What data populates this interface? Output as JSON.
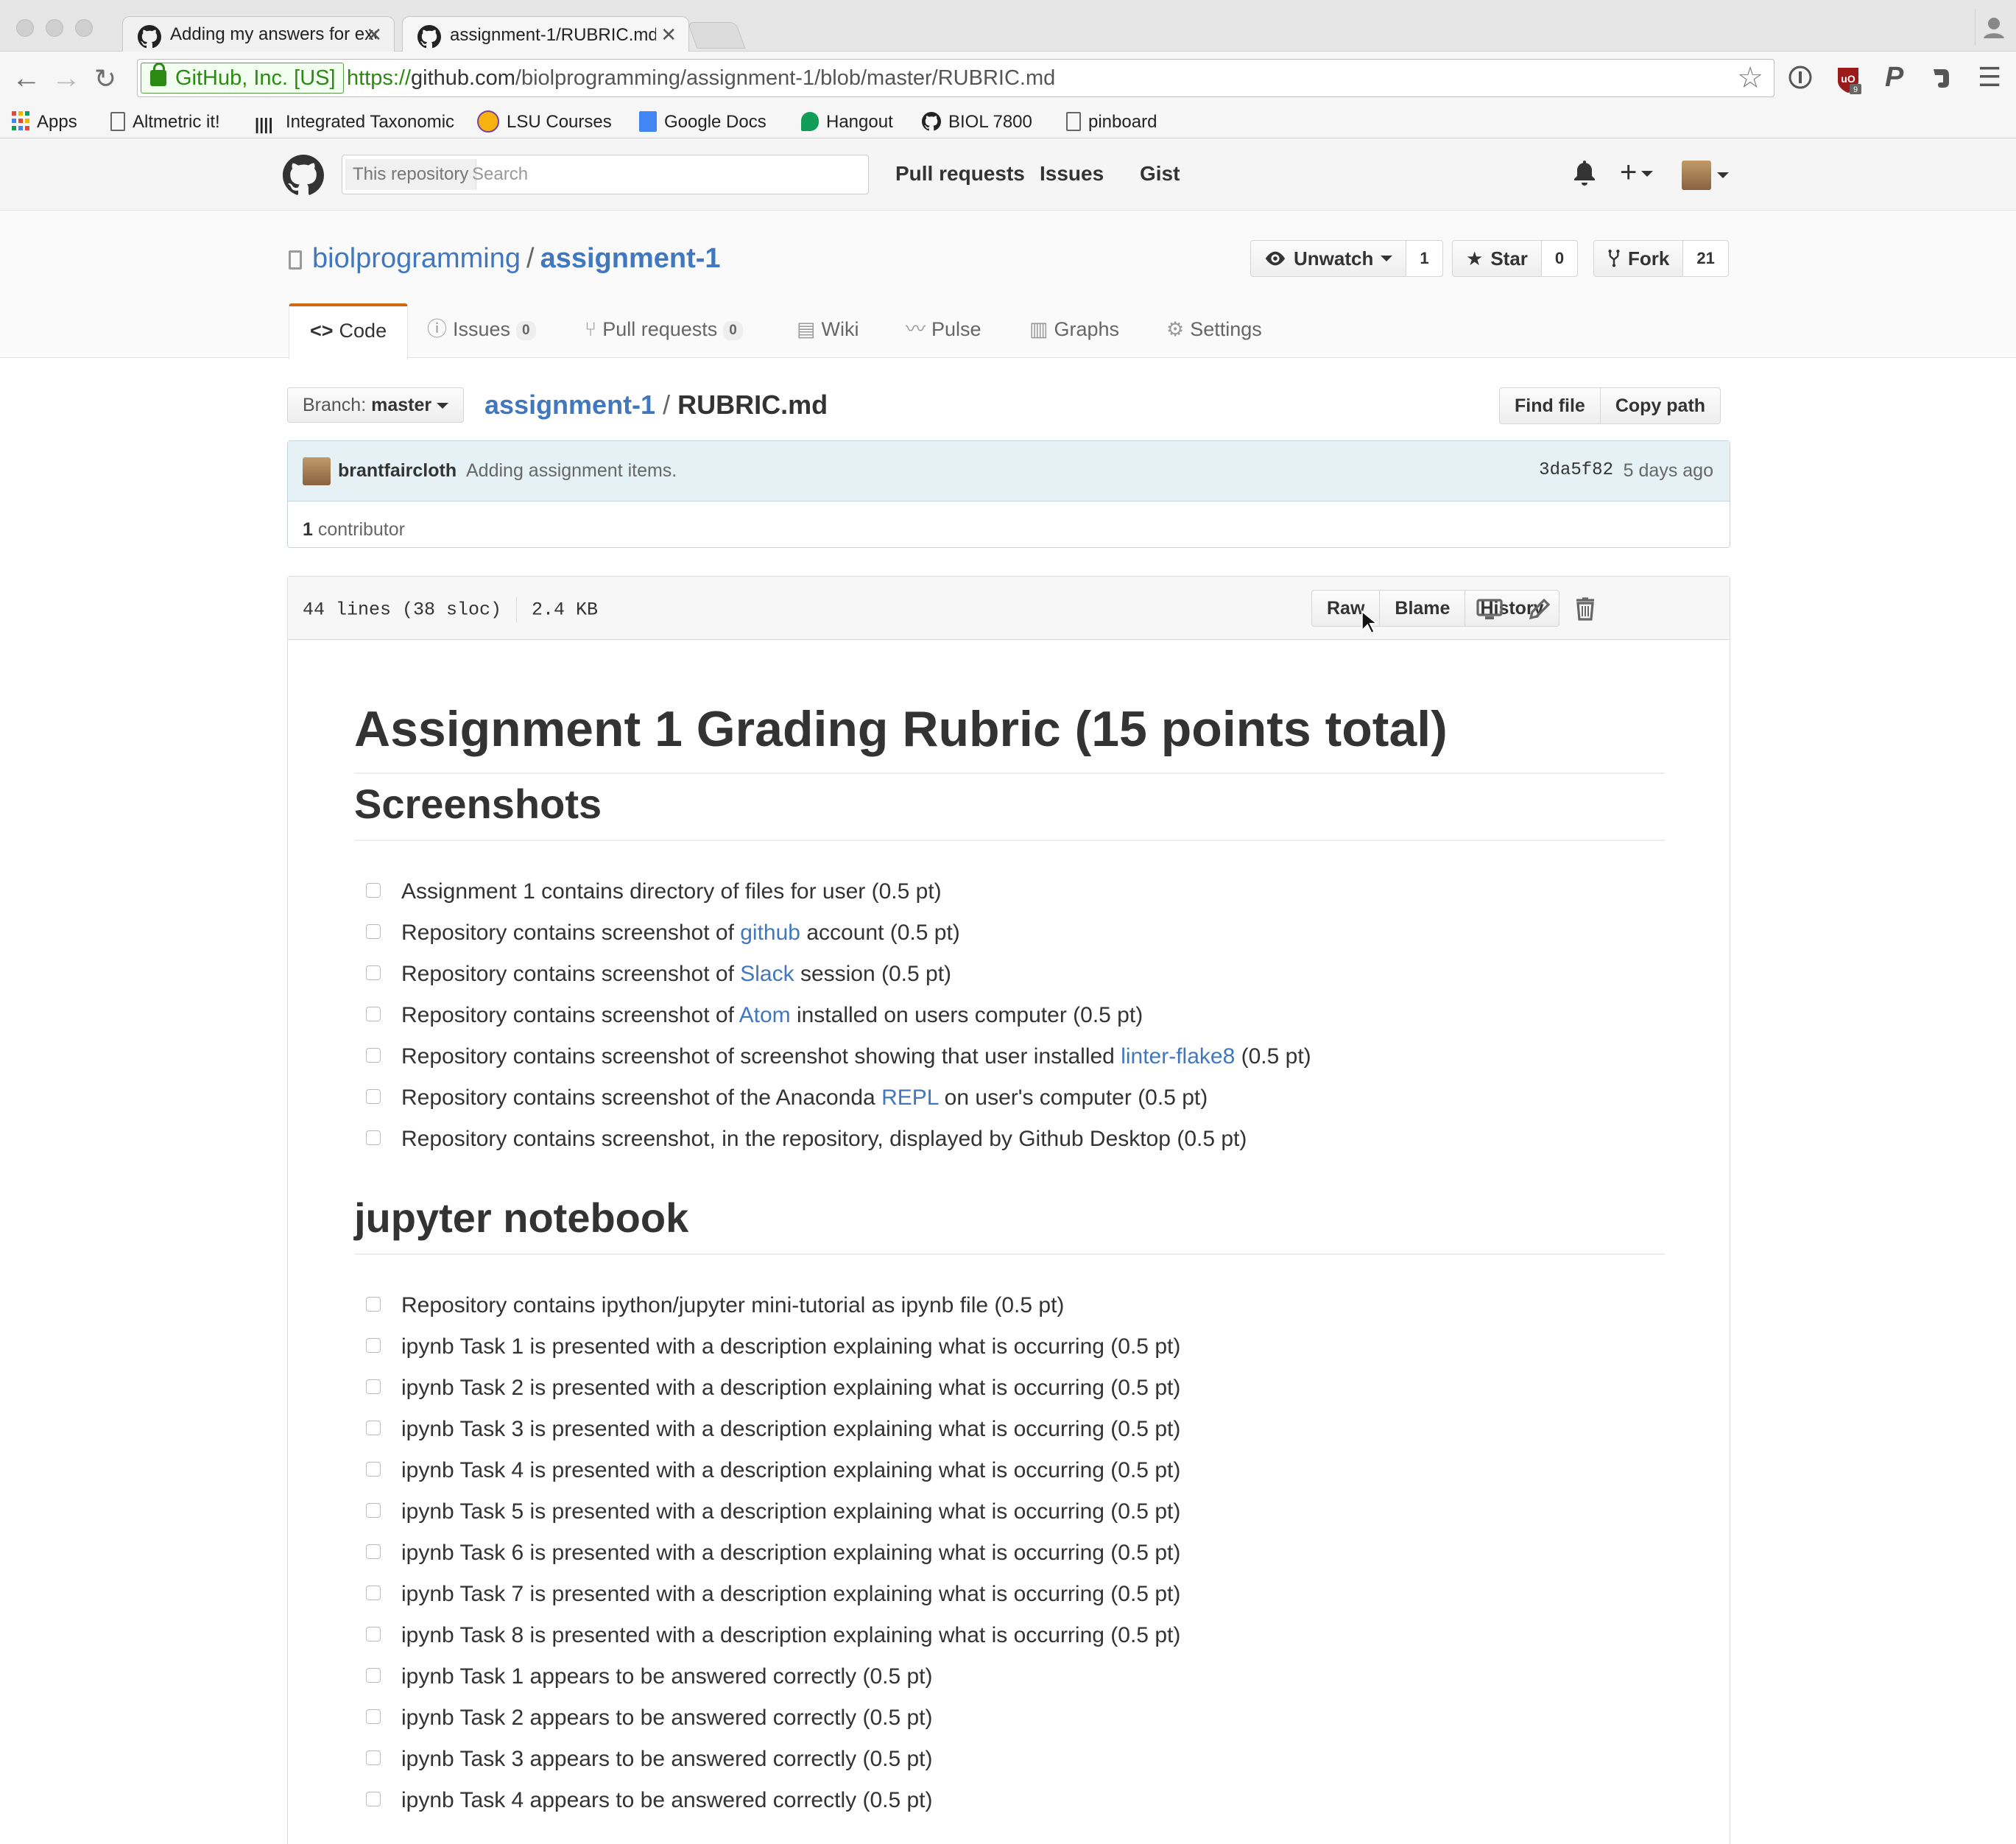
{
  "browser": {
    "tabs": [
      {
        "title": "Adding my answers for exe"
      },
      {
        "title": "assignment-1/RUBRIC.md"
      }
    ],
    "ev_cert": "GitHub, Inc. [US]",
    "url": {
      "scheme": "https://",
      "host": "github.com",
      "path": "/biolprogramming/assignment-1/blob/master/RUBRIC.md"
    },
    "bookmarks": [
      {
        "label": "Apps",
        "icon": "apps-grid-icon"
      },
      {
        "label": "Altmetric it!",
        "icon": "page-icon"
      },
      {
        "label": "Integrated Taxonomic",
        "icon": "itis-icon"
      },
      {
        "label": "LSU Courses",
        "icon": "lsu-icon"
      },
      {
        "label": "Google Docs",
        "icon": "google-docs-icon"
      },
      {
        "label": "Hangout",
        "icon": "hangout-icon"
      },
      {
        "label": "BIOL 7800",
        "icon": "github-icon"
      },
      {
        "label": "pinboard",
        "icon": "page-icon"
      }
    ]
  },
  "github": {
    "search": {
      "scope": "This repository",
      "placeholder": "Search"
    },
    "nav": {
      "pulls": "Pull requests",
      "issues": "Issues",
      "gist": "Gist"
    }
  },
  "repo": {
    "owner": "biolprogramming",
    "separator": "/",
    "name": "assignment-1",
    "watch": {
      "label": "Unwatch",
      "count": "1"
    },
    "star": {
      "label": "Star",
      "count": "0"
    },
    "fork": {
      "label": "Fork",
      "count": "21"
    },
    "tabs": {
      "code": "Code",
      "issues": "Issues",
      "issues_count": "0",
      "pulls": "Pull requests",
      "pulls_count": "0",
      "wiki": "Wiki",
      "pulse": "Pulse",
      "graphs": "Graphs",
      "settings": "Settings"
    }
  },
  "file_nav": {
    "branch_label": "Branch:",
    "branch": "master",
    "crumb_repo": "assignment-1",
    "crumb_sep": "/",
    "crumb_file": "RUBRIC.md",
    "find_file": "Find file",
    "copy_path": "Copy path"
  },
  "commit": {
    "author": "brantfaircloth",
    "message": "Adding assignment items.",
    "sha": "3da5f82",
    "time": "5 days ago",
    "contributors_count": "1",
    "contributors_label": "contributor"
  },
  "file": {
    "lines": "44 lines (38 sloc)",
    "size": "2.4 KB",
    "raw": "Raw",
    "blame": "Blame",
    "history": "History"
  },
  "markdown": {
    "title": "Assignment 1 Grading Rubric (15 points total)",
    "sections": [
      {
        "heading": "Screenshots",
        "items": [
          {
            "pre": "Assignment 1 contains directory of files for user (0.5 pt)",
            "link": "",
            "post": ""
          },
          {
            "pre": "Repository contains screenshot of ",
            "link": "github",
            "post": " account (0.5 pt)"
          },
          {
            "pre": "Repository contains screenshot of ",
            "link": "Slack",
            "post": " session (0.5 pt)"
          },
          {
            "pre": "Repository contains screenshot of ",
            "link": "Atom",
            "post": " installed on users computer (0.5 pt)"
          },
          {
            "pre": "Repository contains screenshot of screenshot showing that user installed ",
            "link": "linter-flake8",
            "post": " (0.5 pt)"
          },
          {
            "pre": "Repository contains screenshot of the Anaconda ",
            "link": "REPL",
            "post": " on user's computer (0.5 pt)"
          },
          {
            "pre": "Repository contains screenshot, in the repository, displayed by Github Desktop (0.5 pt)",
            "link": "",
            "post": ""
          }
        ]
      },
      {
        "heading": "jupyter notebook",
        "items": [
          {
            "pre": "Repository contains ipython/jupyter mini-tutorial as ipynb file (0.5 pt)",
            "link": "",
            "post": ""
          },
          {
            "pre": "ipynb Task 1 is presented with a description explaining what is occurring (0.5 pt)",
            "link": "",
            "post": ""
          },
          {
            "pre": "ipynb Task 2 is presented with a description explaining what is occurring (0.5 pt)",
            "link": "",
            "post": ""
          },
          {
            "pre": "ipynb Task 3 is presented with a description explaining what is occurring (0.5 pt)",
            "link": "",
            "post": ""
          },
          {
            "pre": "ipynb Task 4 is presented with a description explaining what is occurring (0.5 pt)",
            "link": "",
            "post": ""
          },
          {
            "pre": "ipynb Task 5 is presented with a description explaining what is occurring (0.5 pt)",
            "link": "",
            "post": ""
          },
          {
            "pre": "ipynb Task 6 is presented with a description explaining what is occurring (0.5 pt)",
            "link": "",
            "post": ""
          },
          {
            "pre": "ipynb Task 7 is presented with a description explaining what is occurring (0.5 pt)",
            "link": "",
            "post": ""
          },
          {
            "pre": "ipynb Task 8 is presented with a description explaining what is occurring (0.5 pt)",
            "link": "",
            "post": ""
          },
          {
            "pre": "ipynb Task 1 appears to be answered correctly (0.5 pt)",
            "link": "",
            "post": ""
          },
          {
            "pre": "ipynb Task 2 appears to be answered correctly (0.5 pt)",
            "link": "",
            "post": ""
          },
          {
            "pre": "ipynb Task 3 appears to be answered correctly (0.5 pt)",
            "link": "",
            "post": ""
          },
          {
            "pre": "ipynb Task 4 appears to be answered correctly (0.5 pt)",
            "link": "",
            "post": ""
          }
        ]
      }
    ]
  }
}
